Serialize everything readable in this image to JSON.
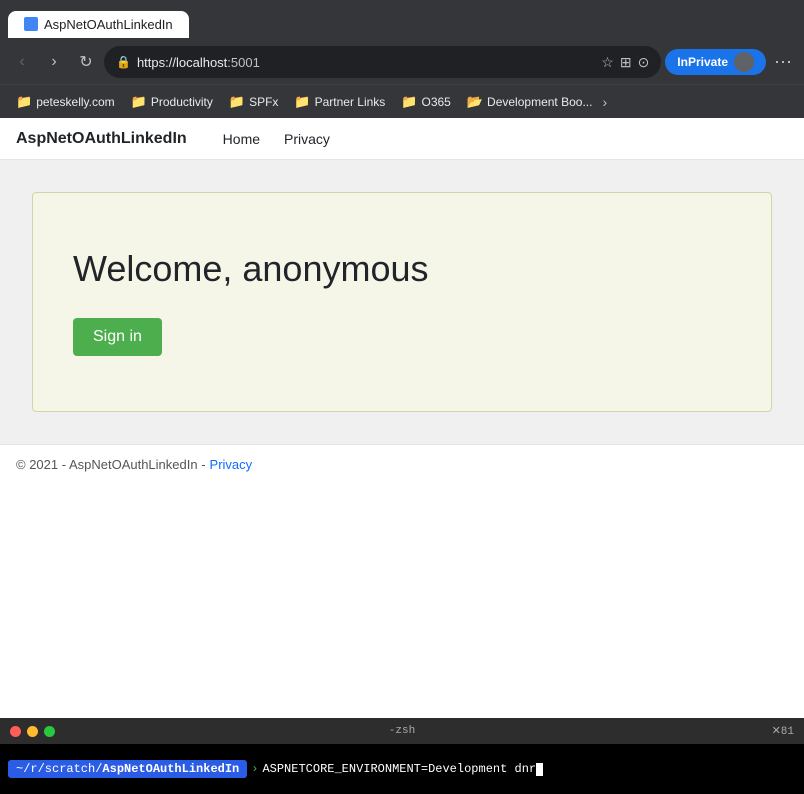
{
  "browser": {
    "tab": {
      "title": "AspNetOAuthLinkedIn"
    },
    "address_bar": {
      "url_host": "https://localhost",
      "url_port": ":5001",
      "full_url": "https://localhost:5001"
    },
    "nav_buttons": {
      "back": "‹",
      "forward": "›",
      "refresh": "↻"
    },
    "inprivate_label": "InPrivate",
    "more_label": "⋯"
  },
  "bookmarks": [
    {
      "id": "peteskelly",
      "label": "peteskelly.com",
      "type": "yellow"
    },
    {
      "id": "productivity",
      "label": "Productivity",
      "type": "yellow"
    },
    {
      "id": "spfx",
      "label": "SPFx",
      "type": "yellow"
    },
    {
      "id": "partner-links",
      "label": "Partner Links",
      "type": "yellow"
    },
    {
      "id": "o365",
      "label": "O365",
      "type": "yellow"
    },
    {
      "id": "dev-boo",
      "label": "Development Boo...",
      "type": "blue"
    }
  ],
  "app": {
    "brand": "AspNetOAuthLinkedIn",
    "nav": [
      {
        "id": "home",
        "label": "Home"
      },
      {
        "id": "privacy",
        "label": "Privacy"
      }
    ]
  },
  "main": {
    "welcome_text": "Welcome, anonymous",
    "signin_label": "Sign in"
  },
  "footer": {
    "copyright": "© 2021 - AspNetOAuthLinkedIn -",
    "privacy_link": "Privacy"
  },
  "terminal": {
    "title": "-zsh",
    "right_label": "✕81",
    "prompt_path_base": "~/r/scratch/",
    "prompt_path_bold": "AspNetOAuthLinkedIn",
    "command": "ASPNETCORE_ENVIRONMENT=Development dnr"
  }
}
